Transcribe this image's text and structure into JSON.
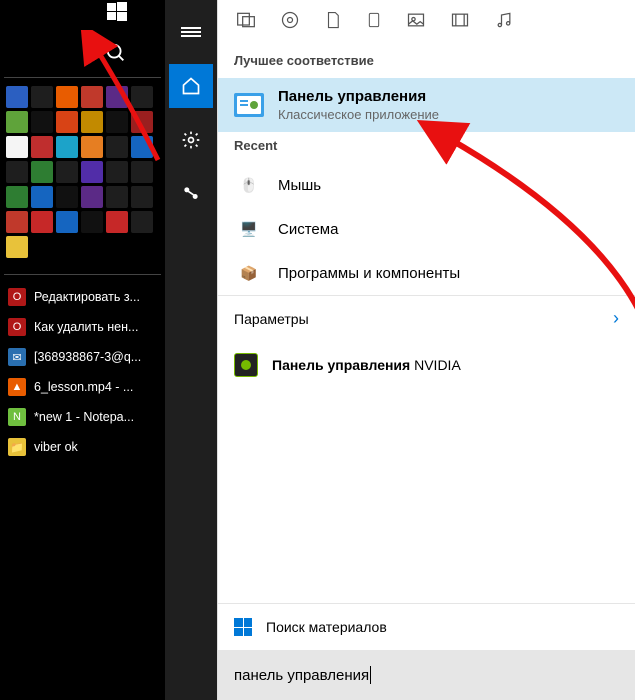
{
  "taskbar": {
    "items": [
      {
        "label": "Редактировать з...",
        "icon_bg": "#b01818",
        "glyph": "O"
      },
      {
        "label": "Как удалить нен...",
        "icon_bg": "#b01818",
        "glyph": "O"
      },
      {
        "label": "[368938867-3@q...",
        "icon_bg": "#2a6fb0",
        "glyph": "✉"
      },
      {
        "label": "6_lesson.mp4 - ...",
        "icon_bg": "#e85c00",
        "glyph": "▲"
      },
      {
        "label": "*new 1 - Notepa...",
        "icon_bg": "#6fbf3f",
        "glyph": "N"
      },
      {
        "label": "viber ok",
        "icon_bg": "#e8c23a",
        "glyph": "📁"
      }
    ]
  },
  "search": {
    "best_match_label": "Лучшее соответствие",
    "best_match": {
      "title": "Панель управления",
      "subtitle": "Классическое приложение"
    },
    "recent_label": "Recent",
    "recent": [
      {
        "title": "Мышь"
      },
      {
        "title": "Система"
      },
      {
        "title": "Программы и компоненты"
      }
    ],
    "params_label": "Параметры",
    "nvidia_bold": "Панель управления",
    "nvidia_rest": " NVIDIA",
    "store_label": "Поиск материалов",
    "query": "панель управления"
  },
  "tile_colors": [
    "#2b5fc1",
    "#1e1e1e",
    "#e85c00",
    "#c0392b",
    "#5b2a86",
    "#1e1e1e",
    "#5fa33a",
    "#111",
    "#d84315",
    "#c28a00",
    "#111",
    "#9a1f1f",
    "#f5f5f5",
    "#bf2e2e",
    "#1ca3c9",
    "#e67e22",
    "#1e1e1e",
    "#1565c0",
    "#1e1e1e",
    "#2e7d32",
    "#1e1e1e",
    "#512da8",
    "#1e1e1e",
    "#1e1e1e",
    "#2e7d32",
    "#1565c0",
    "#111",
    "#5b2a86",
    "#1e1e1e",
    "#1e1e1e",
    "#c0392b",
    "#c62828",
    "#1565c0",
    "#111",
    "#c62828",
    "#1e1e1e",
    "#e8c23a",
    "#1e1e1e",
    "#1e1e1e",
    "#1e1e1e",
    "#1e1e1e",
    "#1e1e1e"
  ]
}
